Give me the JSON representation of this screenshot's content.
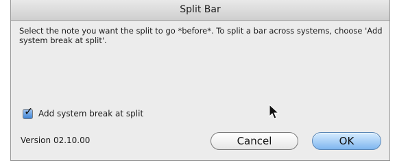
{
  "window": {
    "title": "Split Bar"
  },
  "message": {
    "text": "Select the note you want the split to go *before*. To split a bar across systems, choose 'Add system break at split'."
  },
  "options": {
    "add_system_break": {
      "label": "Add system break at split",
      "checked": true,
      "check_glyph": "✓"
    }
  },
  "footer": {
    "version": "Version 02.10.00"
  },
  "buttons": {
    "cancel": "Cancel",
    "ok": "OK"
  },
  "icons": {
    "cursor": "mouse-pointer-icon"
  },
  "colors": {
    "accent": "#7fb6ef",
    "window_bg": "#ececec"
  }
}
